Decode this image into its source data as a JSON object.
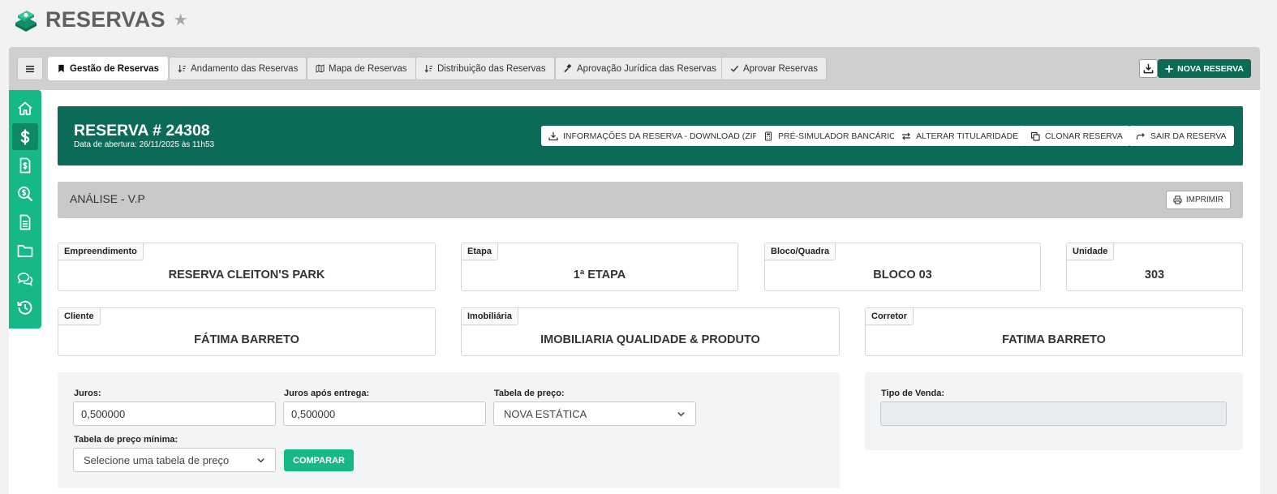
{
  "app": {
    "title": "RESERVAS",
    "logo_icon": "reservas-logo-icon",
    "favorite_icon": "star-icon"
  },
  "tabs": [
    {
      "label": "Gestão de Reservas",
      "icon": "bookmark-icon"
    },
    {
      "label": "Andamento das Reservas",
      "icon": "sort-icon"
    },
    {
      "label": "Mapa de Reservas",
      "icon": "map-icon"
    },
    {
      "label": "Distribuição das Reservas",
      "icon": "sort-icon"
    },
    {
      "label": "Aprovação Jurídica das Reservas",
      "icon": "gavel-icon"
    },
    {
      "label": "Aprovar Reservas",
      "icon": "check-icon"
    }
  ],
  "toolbar": {
    "new_reservation_label": "NOVA RESERVA"
  },
  "sidenav": [
    "home-icon",
    "dollar-icon",
    "invoice-icon",
    "search-dollar-icon",
    "document-icon",
    "folder-icon",
    "chat-icon",
    "history-icon"
  ],
  "reservation": {
    "title": "RESERVA # 24308",
    "opened": "Data de abertura: 26/11/2025 às 11h53",
    "actions": {
      "download_zip": "INFORMAÇÕES DA RESERVA - DOWNLOAD (ZIP)",
      "pre_simulator": "PRÉ-SIMULADOR BANCÁRIO",
      "change_holder": "ALTERAR TITULARIDADE",
      "clone": "CLONAR RESERVA",
      "exit": "SAIR DA RESERVA"
    }
  },
  "analysis": {
    "title": "ANÁLISE - V.P",
    "print_label": "IMPRIMIR"
  },
  "info": {
    "empreendimento": {
      "label": "Empreendimento",
      "value": "RESERVA CLEITON'S PARK"
    },
    "etapa": {
      "label": "Etapa",
      "value": "1ª ETAPA"
    },
    "bloco": {
      "label": "Bloco/Quadra",
      "value": "BLOCO 03"
    },
    "unidade": {
      "label": "Unidade",
      "value": "303"
    },
    "cliente": {
      "label": "Cliente",
      "value": "FÁTIMA BARRETO"
    },
    "imobiliaria": {
      "label": "Imobiliária",
      "value": "IMOBILIARIA QUALIDADE & PRODUTO"
    },
    "corretor": {
      "label": "Corretor",
      "value": "FATIMA BARRETO"
    }
  },
  "form": {
    "juros": {
      "label": "Juros:",
      "value": "0,500000"
    },
    "juros_entrega": {
      "label": "Juros após entrega:",
      "value": "0,500000"
    },
    "tabela_preco": {
      "label": "Tabela de preço:",
      "value": "NOVA ESTÁTICA"
    },
    "tabela_minima": {
      "label": "Tabela de preço mínima:",
      "value": "Selecione uma tabela de preço"
    },
    "compare_label": "COMPARAR",
    "tipo_venda": {
      "label": "Tipo de Venda:",
      "value": ""
    }
  },
  "colors": {
    "primary_dark": "#0c6b58",
    "primary": "#16b887",
    "tabbar": "#cfcfcf"
  }
}
